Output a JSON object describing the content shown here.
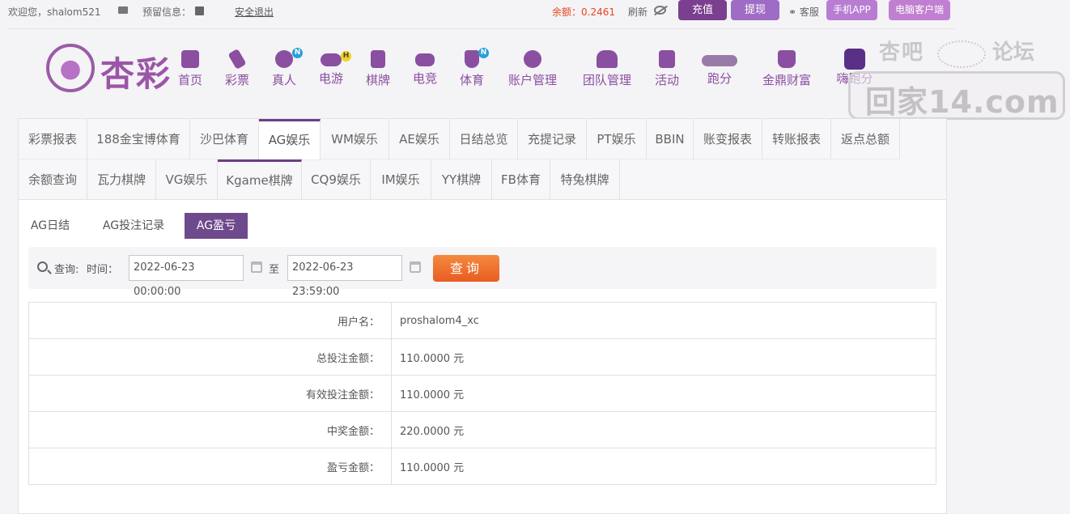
{
  "topbar": {
    "welcome": "欢迎您，shalom521",
    "reserve": "预留信息：",
    "logout": "安全退出",
    "balance": "余额：0.2461",
    "refresh": "刷新",
    "recharge": "充值",
    "withdraw": "提现",
    "service": "客服",
    "app": "手机APP",
    "pc_client": "电脑客户端"
  },
  "brand": {
    "logo_text": "杏彩"
  },
  "nav": [
    {
      "label": "首页",
      "icon": "home-icon"
    },
    {
      "label": "彩票",
      "icon": "ticket-icon"
    },
    {
      "label": "真人",
      "icon": "dealer-icon",
      "badge": "N"
    },
    {
      "label": "电游",
      "icon": "gamepad-icon",
      "badge": "H"
    },
    {
      "label": "棋牌",
      "icon": "cards-icon"
    },
    {
      "label": "电竞",
      "icon": "controller-icon"
    },
    {
      "label": "体育",
      "icon": "trophy-icon",
      "badge": "N"
    },
    {
      "label": "账户管理",
      "icon": "yen-icon"
    },
    {
      "label": "团队管理",
      "icon": "team-icon"
    },
    {
      "label": "活动",
      "icon": "gift-icon"
    },
    {
      "label": "跑分",
      "icon": "run-icon"
    },
    {
      "label": "金鼎财富",
      "icon": "ding-icon"
    },
    {
      "label": "嗨跑分",
      "icon": "hi-icon"
    }
  ],
  "watermark": {
    "top_left": "杏吧",
    "top_right": "论坛",
    "bottom": "回家14.com"
  },
  "tabs_row1": [
    "彩票报表",
    "188金宝博体育",
    "沙巴体育",
    "AG娱乐",
    "WM娱乐",
    "AE娱乐",
    "日结总览",
    "充提记录",
    "PT娱乐",
    "BBIN",
    "账变报表",
    "转账报表",
    "返点总额"
  ],
  "tabs_row2": [
    "余额查询",
    "瓦力棋牌",
    "VG娱乐",
    "Kgame棋牌",
    "CQ9娱乐",
    "IM娱乐",
    "YY棋牌",
    "FB体育",
    "特兔棋牌"
  ],
  "subtabs": [
    "AG日结",
    "AG投注记录",
    "AG盈亏"
  ],
  "query": {
    "label": "查询:",
    "time_label": "时间：",
    "start": "2022-06-23 00:00:00",
    "to": "至",
    "end": "2022-06-23 23:59:00",
    "button": "查询"
  },
  "summary": [
    {
      "label": "用户名：",
      "value": "proshalom4_xc"
    },
    {
      "label": "总投注金额：",
      "value": "110.0000 元"
    },
    {
      "label": "有效投注金额：",
      "value": "110.0000 元"
    },
    {
      "label": "中奖金额：",
      "value": "220.0000 元"
    },
    {
      "label": "盈亏金额：",
      "value": "110.0000 元"
    }
  ]
}
